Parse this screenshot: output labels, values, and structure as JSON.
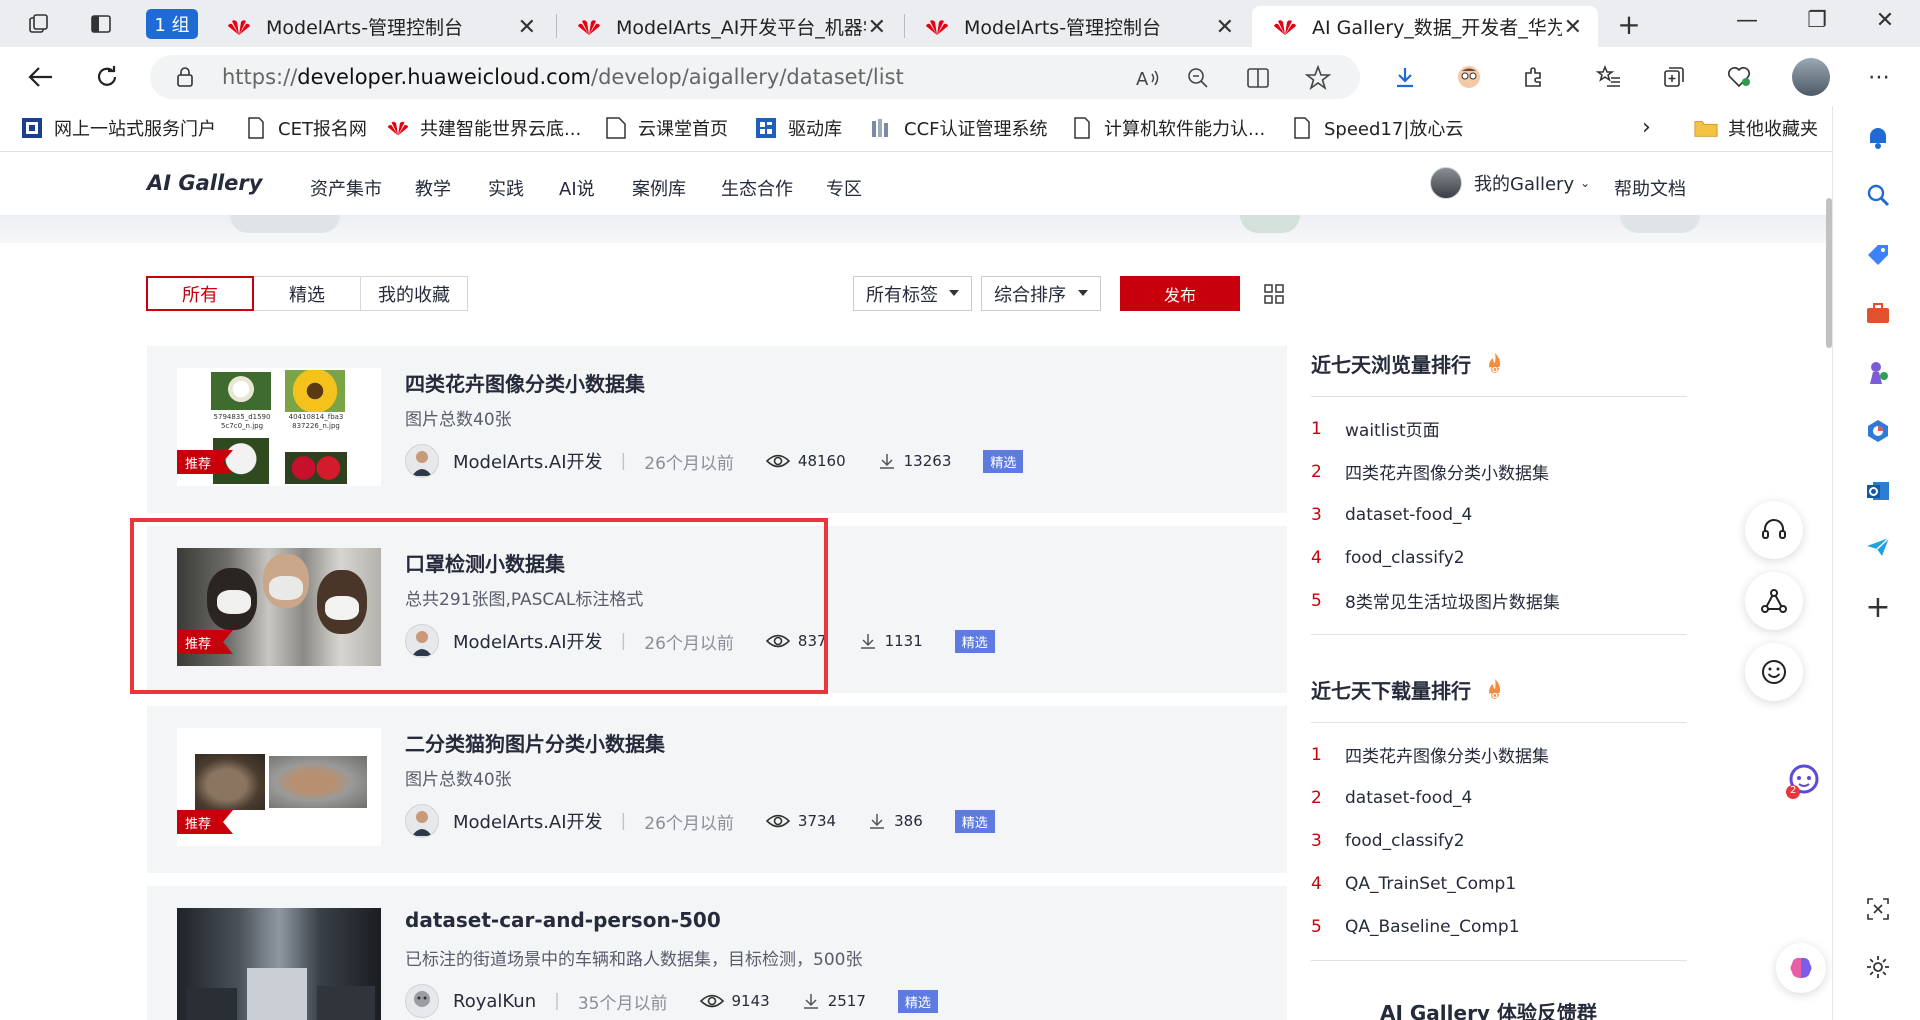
{
  "browser": {
    "tab_group_label": "1 组",
    "tabs": [
      {
        "title": "ModelArts-管理控制台"
      },
      {
        "title": "ModelArts_AI开发平台_机器学习"
      },
      {
        "title": "ModelArts-管理控制台"
      },
      {
        "title": "AI Gallery_数据_开发者_华为云"
      }
    ],
    "url": {
      "scheme": "https://",
      "host": "developer.huaweicloud.com",
      "path": "/develop/aigallery/dataset/list"
    },
    "bookmarks": [
      {
        "label": "网上一站式服务门户",
        "icon": "portal-icon"
      },
      {
        "label": "CET报名网",
        "icon": "page-icon"
      },
      {
        "label": "共建智能世界云底...",
        "icon": "huawei-icon"
      },
      {
        "label": "云课堂首页",
        "icon": "cloud-icon"
      },
      {
        "label": "驱动库",
        "icon": "driver-icon"
      },
      {
        "label": "CCF认证管理系统",
        "icon": "ccf-icon"
      },
      {
        "label": "计算机软件能力认...",
        "icon": "page-icon"
      },
      {
        "label": "Speed17|放心云",
        "icon": "page-icon"
      }
    ],
    "other_bookmarks": "其他收藏夹"
  },
  "site": {
    "logo": "AI Gallery",
    "nav": [
      "资产集市",
      "教学",
      "实践",
      "AI说",
      "案例库",
      "生态合作",
      "专区"
    ],
    "my_gallery": "我的Gallery",
    "help": "帮助文档"
  },
  "filters": {
    "tabs": [
      "所有",
      "精选",
      "我的收藏"
    ],
    "tag_select": "所有标签",
    "sort_select": "综合排序",
    "publish": "发布"
  },
  "datasets": [
    {
      "title": "四类花卉图像分类小数据集",
      "desc": "图片总数40张",
      "author": "ModelArts.AI开发",
      "ago": "26个月以前",
      "views": "48160",
      "downloads": "13263",
      "badge": "推荐",
      "tag": "精选",
      "thumb_captions": [
        "5794835_d1590 5c7c0_n.jpg",
        "40410814_fba3 837226_n.jpg"
      ]
    },
    {
      "title": "口罩检测小数据集",
      "desc": "总共291张图,PASCAL标注格式",
      "author": "ModelArts.AI开发",
      "ago": "26个月以前",
      "views": "837",
      "downloads": "1131",
      "badge": "推荐",
      "tag": "精选"
    },
    {
      "title": "二分类猫狗图片分类小数据集",
      "desc": "图片总数40张",
      "author": "ModelArts.AI开发",
      "ago": "26个月以前",
      "views": "3734",
      "downloads": "386",
      "badge": "推荐",
      "tag": "精选"
    },
    {
      "title": "dataset-car-and-person-500",
      "desc": "已标注的街道场景中的车辆和路人数据集，目标检测，500张",
      "author": "RoyalKun",
      "ago": "35个月以前",
      "views": "9143",
      "downloads": "2517",
      "tag": "精选"
    }
  ],
  "rank_views": {
    "title": "近七天浏览量排行",
    "items": [
      {
        "num": "1",
        "name": "waitlist页面"
      },
      {
        "num": "2",
        "name": "四类花卉图像分类小数据集"
      },
      {
        "num": "3",
        "name": "dataset-food_4"
      },
      {
        "num": "4",
        "name": "food_classify2"
      },
      {
        "num": "5",
        "name": "8类常见生活垃圾图片数据集"
      }
    ]
  },
  "rank_downloads": {
    "title": "近七天下载量排行",
    "items": [
      {
        "num": "1",
        "name": "四类花卉图像分类小数据集"
      },
      {
        "num": "2",
        "name": "dataset-food_4"
      },
      {
        "num": "3",
        "name": "food_classify2"
      },
      {
        "num": "4",
        "name": "QA_TrainSet_Comp1"
      },
      {
        "num": "5",
        "name": "QA_Baseline_Comp1"
      }
    ]
  },
  "rank_feedback": {
    "title": "AI Gallery 体验反馈群"
  },
  "hot_label": "HOT",
  "notif_count": "2",
  "colors": {
    "brand_red": "#c7000b",
    "tag_blue": "#5e7ce0",
    "highlight": "#e8363c",
    "edge_blue": "#1f6bd6"
  }
}
